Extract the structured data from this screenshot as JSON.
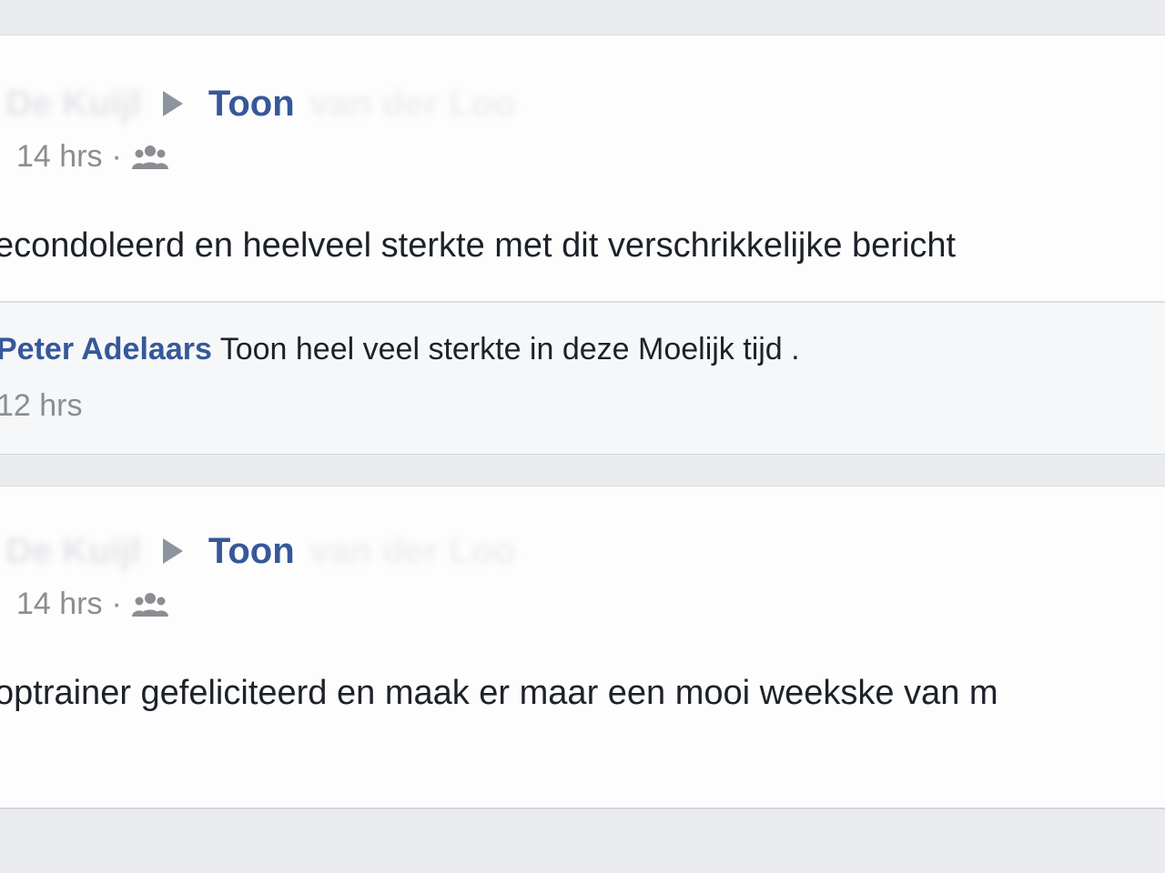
{
  "posts": [
    {
      "author_blurred": "De Kuijl",
      "recipient": "Toon",
      "recipient_rest_blurred": "van der Loo",
      "timestamp": "14 hrs",
      "separator": "·",
      "audience_icon": "group-icon",
      "text": "econdoleerd en heelveel sterkte met dit verschrikkelijke bericht",
      "comment": {
        "author": "Peter Adelaars",
        "text": "Toon heel veel sterkte in deze Moelijk tijd .",
        "time": "12 hrs"
      }
    },
    {
      "author_blurred": "De Kuijl",
      "recipient": "Toon",
      "recipient_rest_blurred": "van der Loo",
      "timestamp": "14 hrs",
      "separator": "·",
      "audience_icon": "group-icon",
      "text": "optrainer gefeliciteerd en maak er maar een mooi weekske van m"
    }
  ],
  "colors": {
    "link_blue": "#365899",
    "meta_gray": "#8a8d91",
    "text_dark": "#1d2129",
    "feed_background": "#e9ebee",
    "comment_background": "#f6f7f9"
  }
}
